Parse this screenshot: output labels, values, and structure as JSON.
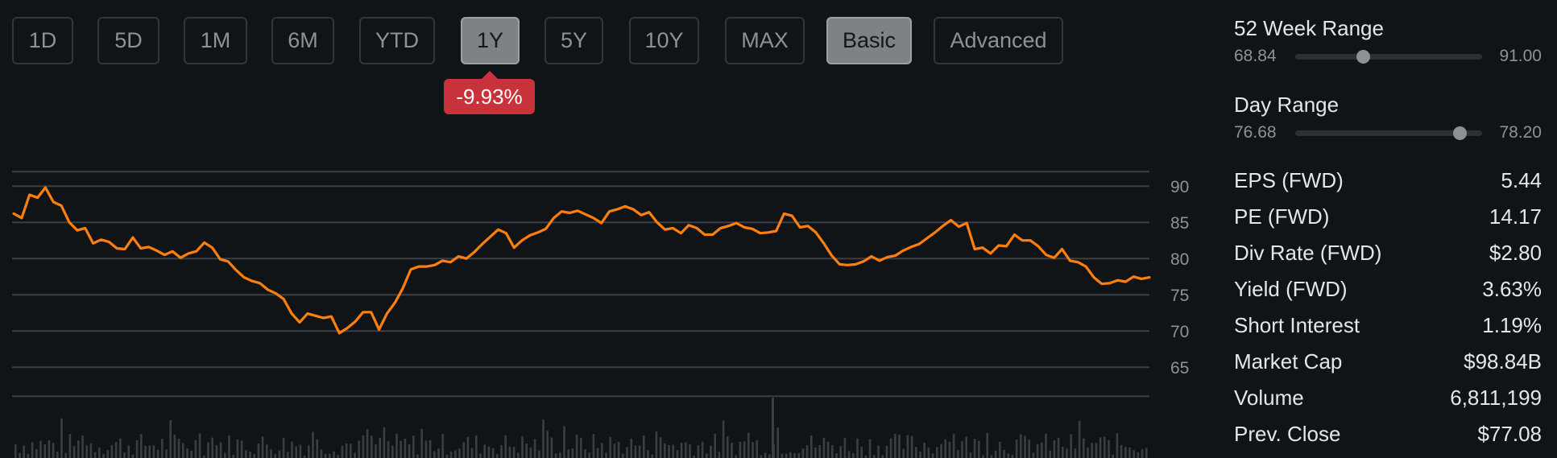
{
  "range_buttons": [
    "1D",
    "5D",
    "1M",
    "6M",
    "YTD",
    "1Y",
    "5Y",
    "10Y",
    "MAX"
  ],
  "active_range": "1Y",
  "mode_buttons": [
    "Basic",
    "Advanced"
  ],
  "active_mode": "Basic",
  "change_badge": "-9.93%",
  "colors": {
    "background": "#111417",
    "line": "#ff7f0e",
    "negative": "#c8323a",
    "volume": "#3a3e43",
    "grid": "#3a3f44"
  },
  "week52": {
    "title": "52 Week Range",
    "low": "68.84",
    "high": "91.00",
    "position": 0.36
  },
  "day_range": {
    "title": "Day Range",
    "low": "76.68",
    "high": "78.20",
    "position": 0.88
  },
  "stats": [
    {
      "label": "EPS (FWD)",
      "value": "5.44"
    },
    {
      "label": "PE (FWD)",
      "value": "14.17"
    },
    {
      "label": "Div Rate (FWD)",
      "value": "$2.80"
    },
    {
      "label": "Yield (FWD)",
      "value": "3.63%"
    },
    {
      "label": "Short Interest",
      "value": "1.19%"
    },
    {
      "label": "Market Cap",
      "value": "$98.84B"
    },
    {
      "label": "Volume",
      "value": "6,811,199"
    },
    {
      "label": "Prev. Close",
      "value": "$77.08"
    }
  ],
  "chart_data": {
    "type": "line",
    "y_ticks": [
      "90",
      "85",
      "80",
      "75",
      "70",
      "65"
    ],
    "ylim": [
      61,
      92
    ],
    "grid": true,
    "series": [
      {
        "values": [
          86.2,
          85.6,
          88.8,
          88.4,
          89.8,
          87.8,
          87.3,
          85,
          83.9,
          84.2,
          82.1,
          82.6,
          82.3,
          81.4,
          81.3,
          82.9,
          81.4,
          81.6,
          81.1,
          80.5,
          81,
          80.1,
          80.7,
          81,
          82.2,
          81.5,
          79.9,
          79.6,
          78.4,
          77.4,
          76.9,
          76.6,
          75.7,
          75.2,
          74.4,
          72.4,
          71.2,
          72.4,
          72.1,
          71.8,
          72,
          69.7,
          70.4,
          71.3,
          72.6,
          72.6,
          70.2,
          72.4,
          73.9,
          75.9,
          78.5,
          78.9,
          78.9,
          79.1,
          79.7,
          79.5,
          80.3,
          80,
          80.9,
          82,
          83,
          84,
          83.5,
          81.5,
          82.5,
          83.2,
          83.6,
          84.1,
          85.6,
          86.5,
          86.3,
          86.6,
          86.1,
          85.6,
          84.9,
          86.5,
          86.8,
          87.2,
          86.8,
          86,
          86.4,
          85,
          84,
          84.2,
          83.5,
          84.6,
          84.2,
          83.3,
          83.3,
          84.2,
          84.5,
          84.9,
          84.3,
          84.1,
          83.5,
          83.6,
          83.8,
          86.2,
          85.9,
          84.3,
          84.5,
          83.6,
          82.1,
          80.4,
          79.2,
          79.1,
          79.2,
          79.6,
          80.3,
          79.7,
          80.2,
          80.4,
          81.1,
          81.6,
          82,
          82.8,
          83.6,
          84.5,
          85.3,
          84.4,
          84.9,
          81.3,
          81.5,
          80.7,
          81.8,
          81.7,
          83.3,
          82.5,
          82.5,
          81.7,
          80.5,
          80.1,
          81.3,
          79.7,
          79.5,
          78.9,
          77.4,
          76.5,
          76.6,
          77,
          76.8,
          77.5,
          77.2,
          77.4
        ]
      }
    ]
  }
}
